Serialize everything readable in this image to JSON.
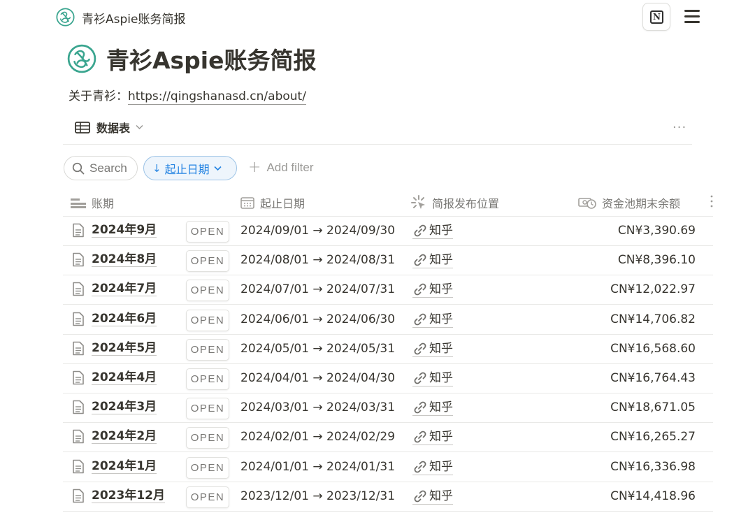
{
  "topbar": {
    "title": "青衫Aspie账务简报",
    "logo_icon": "green-knot-logo-icon",
    "notion_icon": "notion-icon",
    "menu_icon": "hamburger-menu-icon"
  },
  "page": {
    "title": "青衫Aspie账务简报",
    "about_label": "关于青衫：",
    "about_link": "https://qingshanasd.cn/about/",
    "brand_color": "#3aa58f"
  },
  "view": {
    "name": "数据表",
    "more": "···"
  },
  "toolbar": {
    "search_placeholder": "Search",
    "sort_label": "起止日期",
    "sort_arrow": "↓",
    "add_filter_label": "Add filter",
    "add_filter_plus": "+",
    "accent_color": "#2383e2"
  },
  "table": {
    "columns": [
      "账期",
      "起止日期",
      "简报发布位置",
      "资金池期末余额"
    ],
    "open_label": "OPEN",
    "rows": [
      {
        "period": "2024年9月",
        "dates": "2024/09/01 → 2024/09/30",
        "location": "知乎",
        "balance": "CN¥3,390.69"
      },
      {
        "period": "2024年8月",
        "dates": "2024/08/01 → 2024/08/31",
        "location": "知乎",
        "balance": "CN¥8,396.10"
      },
      {
        "period": "2024年7月",
        "dates": "2024/07/01 → 2024/07/31",
        "location": "知乎",
        "balance": "CN¥12,022.97"
      },
      {
        "period": "2024年6月",
        "dates": "2024/06/01 → 2024/06/30",
        "location": "知乎",
        "balance": "CN¥14,706.82"
      },
      {
        "period": "2024年5月",
        "dates": "2024/05/01 → 2024/05/31",
        "location": "知乎",
        "balance": "CN¥16,568.60"
      },
      {
        "period": "2024年4月",
        "dates": "2024/04/01 → 2024/04/30",
        "location": "知乎",
        "balance": "CN¥16,764.43"
      },
      {
        "period": "2024年3月",
        "dates": "2024/03/01 → 2024/03/31",
        "location": "知乎",
        "balance": "CN¥18,671.05"
      },
      {
        "period": "2024年2月",
        "dates": "2024/02/01 → 2024/02/29",
        "location": "知乎",
        "balance": "CN¥16,265.27"
      },
      {
        "period": "2024年1月",
        "dates": "2024/01/01 → 2024/01/31",
        "location": "知乎",
        "balance": "CN¥16,336.98"
      },
      {
        "period": "2023年12月",
        "dates": "2023/12/01 → 2023/12/31",
        "location": "知乎",
        "balance": "CN¥14,418.96"
      }
    ]
  }
}
